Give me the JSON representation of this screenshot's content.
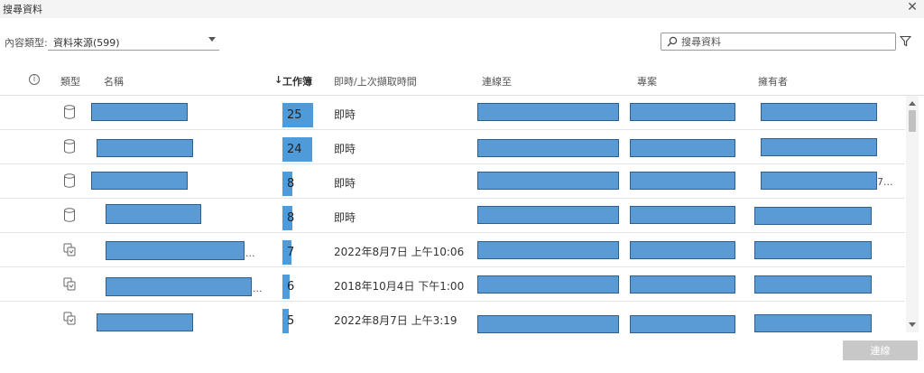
{
  "window": {
    "title": "搜尋資料",
    "close_glyph": "✕"
  },
  "filter": {
    "label": "內容類型:",
    "value": "資料來源(599)"
  },
  "search": {
    "placeholder": "搜尋資料",
    "value": ""
  },
  "columns": {
    "info": "i",
    "type": "類型",
    "name": "名稱",
    "workbooks_arrow": "↓",
    "workbooks": "工作簿",
    "live_last_extract": "即時/上次擷取時間",
    "connected_to": "連線至",
    "project": "專案",
    "owner": "擁有者"
  },
  "rows": [
    {
      "type_icon": "database-icon",
      "workbooks": "25",
      "refresh": "即時",
      "name_suffix": "",
      "owner_suffix": ""
    },
    {
      "type_icon": "database-icon",
      "workbooks": "24",
      "refresh": "即時",
      "name_suffix": "",
      "owner_suffix": ""
    },
    {
      "type_icon": "database-icon",
      "workbooks": "8",
      "refresh": "即時",
      "name_suffix": "",
      "owner_suffix": "7..."
    },
    {
      "type_icon": "database-icon",
      "workbooks": "8",
      "refresh": "即時",
      "name_suffix": "",
      "owner_suffix": ""
    },
    {
      "type_icon": "extract-icon",
      "workbooks": "7",
      "refresh": "2022年8月7日 上午10:06",
      "name_suffix": "...",
      "owner_suffix": ""
    },
    {
      "type_icon": "extract-icon",
      "workbooks": "6",
      "refresh": "2018年10月4日 下午1:00",
      "name_suffix": "...",
      "owner_suffix": ""
    },
    {
      "type_icon": "extract-icon",
      "workbooks": "5",
      "refresh": "2022年8月7日 上午3:19",
      "name_suffix": "",
      "owner_suffix": ""
    }
  ],
  "workbooks_max": 25,
  "colors": {
    "redaction": "#5b9bd5",
    "bar": "#4f9ad8",
    "button_disabled": "#c8c8c8"
  },
  "footer": {
    "connect_label": "連線"
  }
}
